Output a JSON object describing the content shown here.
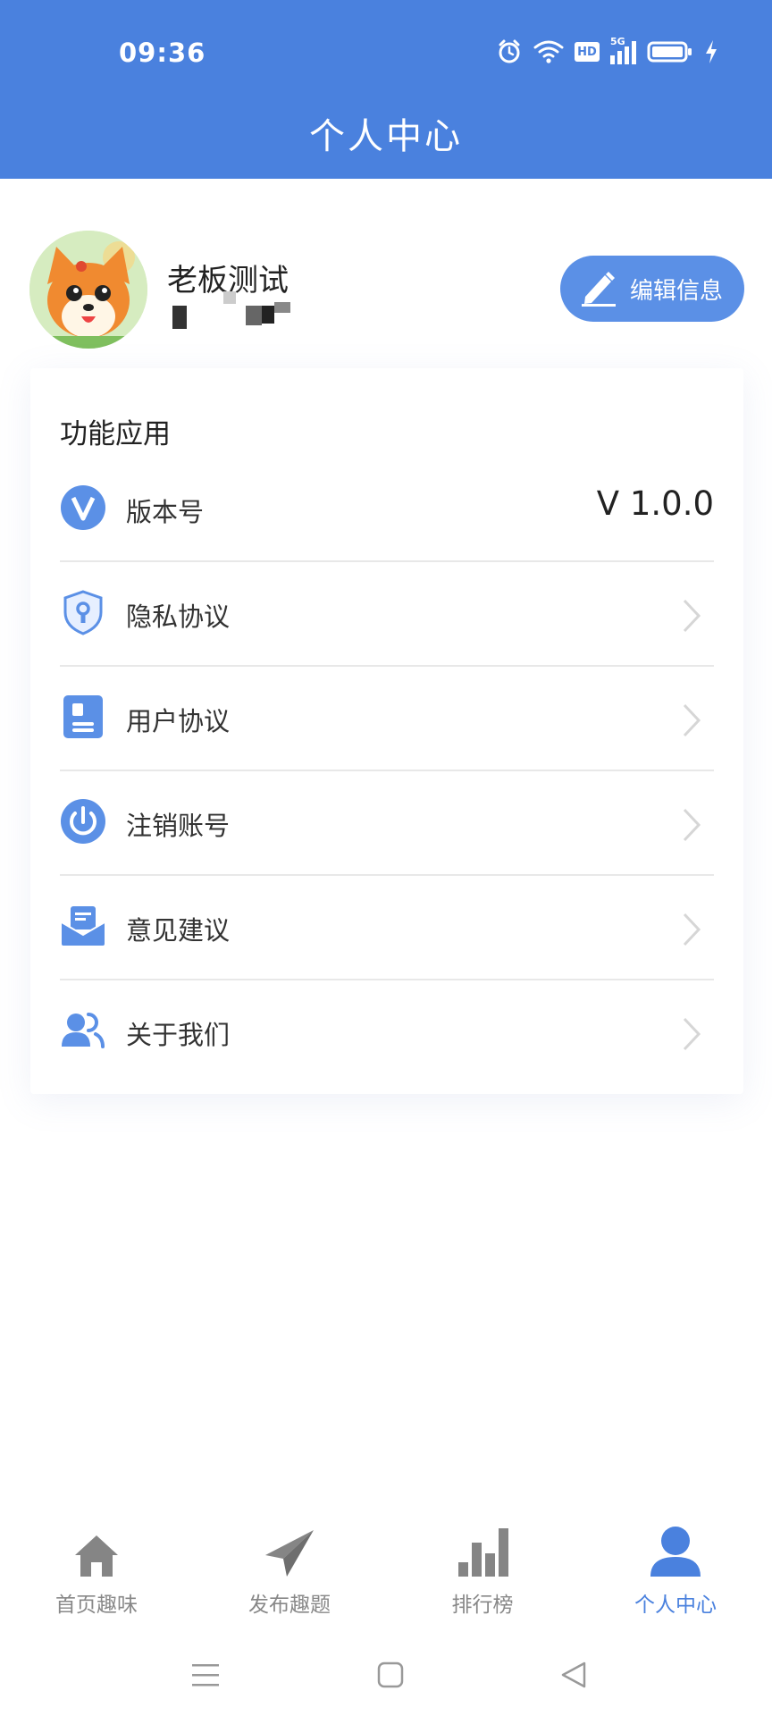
{
  "status_bar": {
    "time": "09:36",
    "icons": [
      "alarm-icon",
      "wifi-icon",
      "hd-icon",
      "signal-5g-icon",
      "battery-icon",
      "charging-icon"
    ],
    "hd_text": "HD",
    "net_text": "5G"
  },
  "header": {
    "title": "个人中心"
  },
  "profile": {
    "username": "老板测试",
    "edit_label": "编辑信息"
  },
  "card": {
    "title": "功能应用",
    "items": [
      {
        "label": "版本号",
        "value": "V 1.0.0",
        "icon": "version-icon"
      },
      {
        "label": "隐私协议",
        "icon": "shield-lock-icon"
      },
      {
        "label": "用户协议",
        "icon": "document-icon"
      },
      {
        "label": "注销账号",
        "icon": "power-icon"
      },
      {
        "label": "意见建议",
        "icon": "mail-icon"
      },
      {
        "label": "关于我们",
        "icon": "users-icon"
      }
    ]
  },
  "bottom_nav": {
    "items": [
      {
        "label": "首页趣味",
        "icon": "home-icon"
      },
      {
        "label": "发布趣题",
        "icon": "paper-plane-icon"
      },
      {
        "label": "排行榜",
        "icon": "bar-chart-icon"
      },
      {
        "label": "个人中心",
        "icon": "person-icon",
        "active": true
      }
    ]
  },
  "colors": {
    "primary": "#4a81de",
    "button": "#5b90e6",
    "icon_blue": "#5b90e6",
    "inactive": "#888888"
  }
}
